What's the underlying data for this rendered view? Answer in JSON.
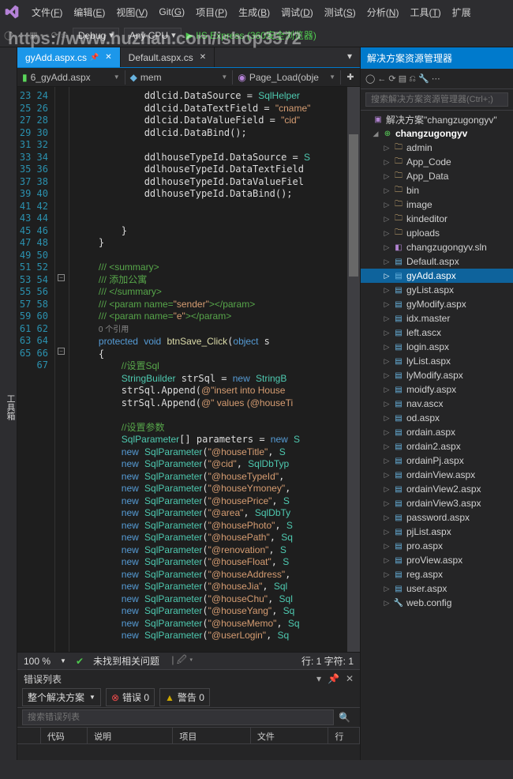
{
  "menu": {
    "items": [
      "文件(F)",
      "编辑(E)",
      "视图(V)",
      "Git(G)",
      "项目(P)",
      "生成(B)",
      "调试(D)",
      "测试(S)",
      "分析(N)",
      "工具(T)",
      "扩展"
    ]
  },
  "toolbar": {
    "config": "Debug",
    "platform": "Any CPU",
    "run": "IIS Express (360安全浏览器)"
  },
  "watermark": "https://www.huzhan.com/ishop3572",
  "tool_tab": "工具箱",
  "tabs": [
    {
      "label": "gyAdd.aspx.cs",
      "active": true,
      "pinned": true
    },
    {
      "label": "Default.aspx.cs",
      "active": false
    }
  ],
  "nav": {
    "left": "6_gyAdd.aspx",
    "mid": "mem",
    "right": "Page_Load(obje"
  },
  "linestart": 23,
  "fold_lines": [
    38,
    44
  ],
  "code_lines": [
    "            ddlcid.DataSource = <t>SqlHelper</t>",
    "            ddlcid.DataTextField = <s>\"cname\"</s>",
    "            ddlcid.DataValueField = <s>\"cid\"</s>",
    "            ddlcid.DataBind();",
    "",
    "            ddlhouseTypeId.DataSource = <t>S</t>",
    "            ddlhouseTypeId.DataTextField",
    "            ddlhouseTypeId.DataValueFiel",
    "            ddlhouseTypeId.DataBind();",
    "",
    "",
    "        }",
    "    }",
    "",
    "    <c>/// &lt;summary&gt;</c>",
    "    <c>/// 添加公寓</c>",
    "    <c>/// &lt;/summary&gt;</c>",
    "    <c>/// &lt;param name=</c><s>\"sender\"</s><c>&gt;&lt;/param&gt;</c>",
    "    <c>/// &lt;param name=</c><s>\"e\"</s><c>&gt;&lt;/param&gt;</c>",
    "    <r>0 个引用</r>",
    "    <k>protected</k> <k>void</k> <f>btnSave_Click</f>(<k>object</k> s",
    "    {",
    "        <c>//设置Sql</c>",
    "        <t>StringBuilder</t> strSql = <k>new</k> <t>StringB</t>",
    "        strSql.Append(<s>@\"insert into House</s>",
    "        strSql.Append(<s>@\" values (@houseTi</s>",
    "",
    "        <c>//设置参数</c>",
    "        <t>SqlParameter</t>[] parameters = <k>new</k> <t>S</t>",
    "        <k>new</k> <t>SqlParameter</t>(<s>\"@houseTitle\"</s>, <t>S</t>",
    "        <k>new</k> <t>SqlParameter</t>(<s>\"@cid\"</s>, <t>SqlDbTyp</t>",
    "        <k>new</k> <t>SqlParameter</t>(<s>\"@houseTypeId\"</s>,",
    "        <k>new</k> <t>SqlParameter</t>(<s>\"@houseYmoney\"</s>,",
    "        <k>new</k> <t>SqlParameter</t>(<s>\"@housePrice\"</s>, <t>S</t>",
    "        <k>new</k> <t>SqlParameter</t>(<s>\"@area\"</s>, <t>SqlDbTy</t>",
    "        <k>new</k> <t>SqlParameter</t>(<s>\"@housePhoto\"</s>, <t>S</t>",
    "        <k>new</k> <t>SqlParameter</t>(<s>\"@housePath\"</s>, <t>Sq</t>",
    "        <k>new</k> <t>SqlParameter</t>(<s>\"@renovation\"</s>, <t>S</t>",
    "        <k>new</k> <t>SqlParameter</t>(<s>\"@houseFloat\"</s>, <t>S</t>",
    "        <k>new</k> <t>SqlParameter</t>(<s>\"@houseAddress\"</s>,",
    "        <k>new</k> <t>SqlParameter</t>(<s>\"@houseJia\"</s>, <t>Sql</t>",
    "        <k>new</k> <t>SqlParameter</t>(<s>\"@houseChu\"</s>, <t>Sql</t>",
    "        <k>new</k> <t>SqlParameter</t>(<s>\"@houseYang\"</s>, <t>Sq</t>",
    "        <k>new</k> <t>SqlParameter</t>(<s>\"@houseMemo\"</s>, <t>Sq</t>",
    "        <k>new</k> <t>SqlParameter</t>(<s>\"@userLogin\"</s>, <t>Sq</t>"
  ],
  "status": {
    "zoom": "100 %",
    "msg": "未找到相关问题",
    "pos": "行: 1   字符: 1"
  },
  "errorlist": {
    "title": "错误列表",
    "scope": "整个解决方案",
    "errors": "错误 0",
    "warnings": "警告 0",
    "search_ph": "搜索错误列表",
    "cols": [
      "",
      "代码",
      "说明",
      "项目",
      "文件",
      "行"
    ]
  },
  "explorer": {
    "title": "解决方案资源管理器",
    "search_ph": "搜索解决方案资源管理器(Ctrl+;)",
    "solution": "解决方案\"changzugongyv\"",
    "project": "changzugongyv",
    "folders": [
      "admin",
      "App_Code",
      "App_Data",
      "bin",
      "image",
      "kindeditor",
      "uploads"
    ],
    "files": [
      {
        "n": "changzugongyv.sln",
        "t": "sln"
      },
      {
        "n": "Default.aspx",
        "t": "aspx"
      },
      {
        "n": "gyAdd.aspx",
        "t": "aspx",
        "sel": true
      },
      {
        "n": "gyList.aspx",
        "t": "aspx"
      },
      {
        "n": "gyModify.aspx",
        "t": "aspx"
      },
      {
        "n": "idx.master",
        "t": "aspx"
      },
      {
        "n": "left.ascx",
        "t": "aspx"
      },
      {
        "n": "login.aspx",
        "t": "aspx"
      },
      {
        "n": "lyList.aspx",
        "t": "aspx"
      },
      {
        "n": "lyModify.aspx",
        "t": "aspx"
      },
      {
        "n": "moidfy.aspx",
        "t": "aspx"
      },
      {
        "n": "nav.ascx",
        "t": "aspx"
      },
      {
        "n": "od.aspx",
        "t": "aspx"
      },
      {
        "n": "ordain.aspx",
        "t": "aspx"
      },
      {
        "n": "ordain2.aspx",
        "t": "aspx"
      },
      {
        "n": "ordainPj.aspx",
        "t": "aspx"
      },
      {
        "n": "ordainView.aspx",
        "t": "aspx"
      },
      {
        "n": "ordainView2.aspx",
        "t": "aspx"
      },
      {
        "n": "ordainView3.aspx",
        "t": "aspx"
      },
      {
        "n": "password.aspx",
        "t": "aspx"
      },
      {
        "n": "pjList.aspx",
        "t": "aspx"
      },
      {
        "n": "pro.aspx",
        "t": "aspx"
      },
      {
        "n": "proView.aspx",
        "t": "aspx"
      },
      {
        "n": "reg.aspx",
        "t": "aspx"
      },
      {
        "n": "user.aspx",
        "t": "aspx"
      },
      {
        "n": "web.config",
        "t": "cfg"
      }
    ]
  }
}
